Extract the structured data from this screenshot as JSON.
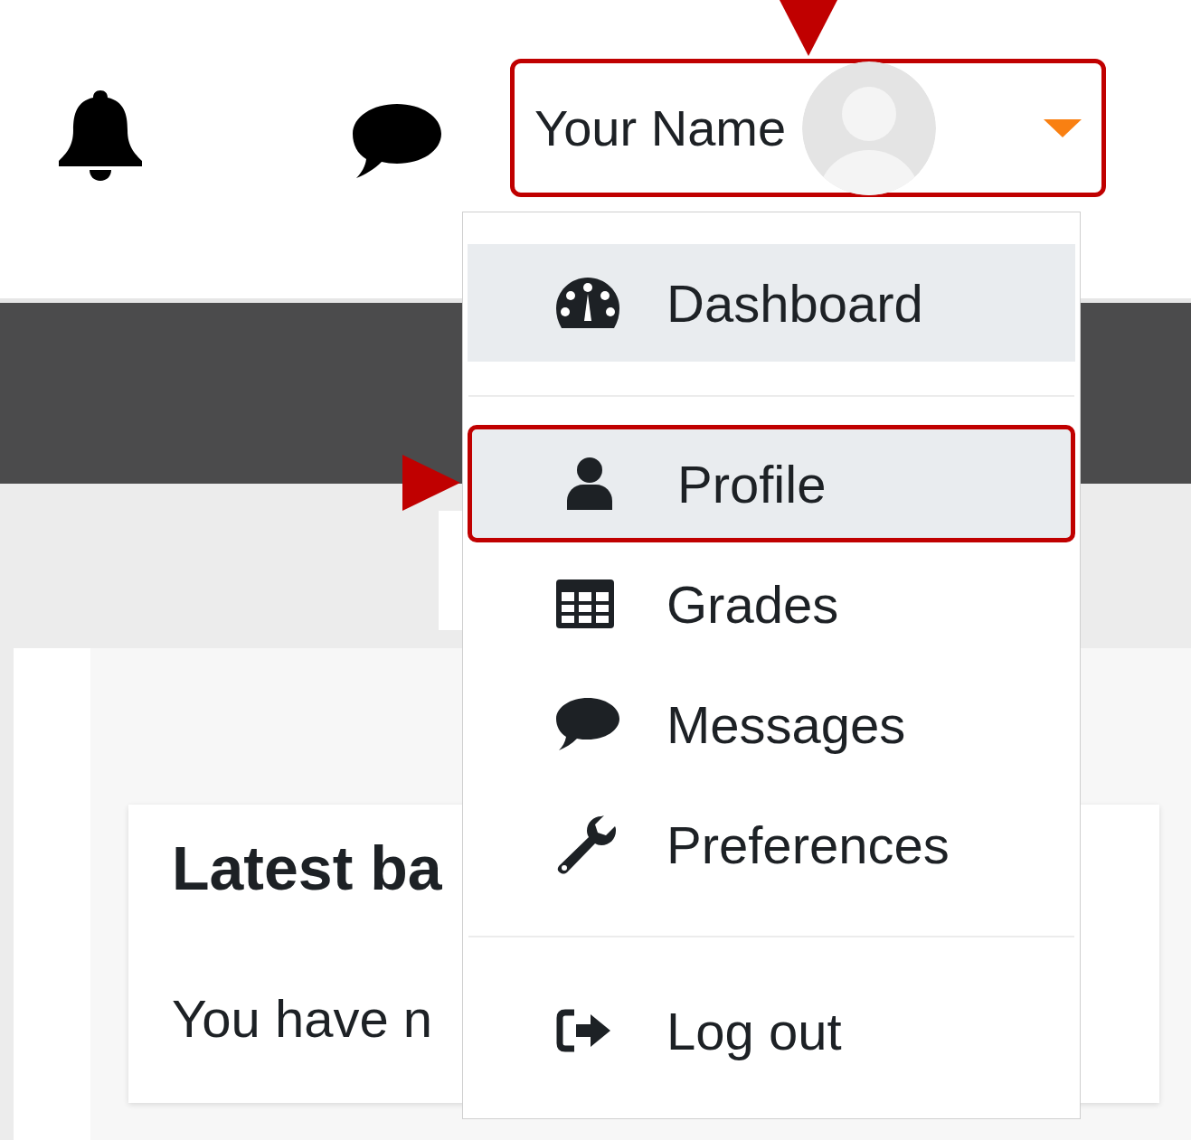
{
  "navbar": {
    "user_menu": {
      "name": "Your Name",
      "callout": true
    }
  },
  "card": {
    "heading": "Latest ba",
    "text": "You have n"
  },
  "user_dropdown": {
    "groups": [
      [
        {
          "label": "Dashboard",
          "highlighted": true,
          "callout": false
        }
      ],
      [
        {
          "label": "Profile",
          "highlighted": true,
          "callout": true
        },
        {
          "label": "Grades",
          "highlighted": false,
          "callout": false
        },
        {
          "label": "Messages",
          "highlighted": false,
          "callout": false
        },
        {
          "label": "Preferences",
          "highlighted": false,
          "callout": false
        }
      ],
      [
        {
          "label": "Log out",
          "highlighted": false,
          "callout": false
        }
      ]
    ]
  }
}
